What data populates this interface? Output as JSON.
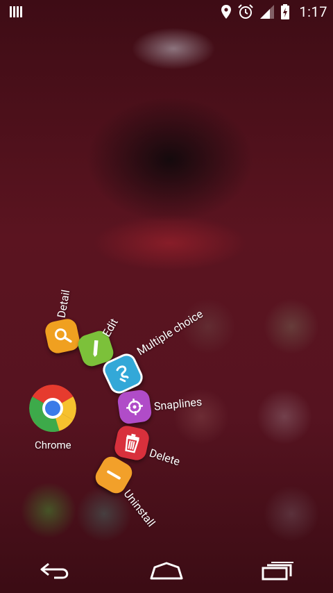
{
  "status_bar": {
    "time": "1:17",
    "icons": [
      "notification-bars-icon",
      "location-pin-icon",
      "alarm-icon",
      "signal-icon",
      "battery-charging-icon"
    ]
  },
  "home": {
    "chrome_app": {
      "label": "Chrome",
      "icon": "chrome-icon"
    }
  },
  "radial_menu": {
    "items": [
      {
        "id": "detail",
        "label": "Detail",
        "icon": "magnifier-icon",
        "color": "#f0a020"
      },
      {
        "id": "edit",
        "label": "Edit",
        "icon": "pencil-icon",
        "color": "#7cc13a"
      },
      {
        "id": "multiple_choice",
        "label": "Multiple choice",
        "icon": "multi-select-icon",
        "color": "#33a8d8"
      },
      {
        "id": "snaplines",
        "label": "Snaplines",
        "icon": "crosshair-icon",
        "color": "#b04cc8"
      },
      {
        "id": "delete",
        "label": "Delete",
        "icon": "trash-icon",
        "color": "#d8303c"
      },
      {
        "id": "uninstall",
        "label": "Uninstall",
        "icon": "minus-icon",
        "color": "#f2a02a"
      }
    ]
  },
  "nav_bar": {
    "buttons": [
      "back-icon",
      "home-icon",
      "recents-icon"
    ]
  }
}
